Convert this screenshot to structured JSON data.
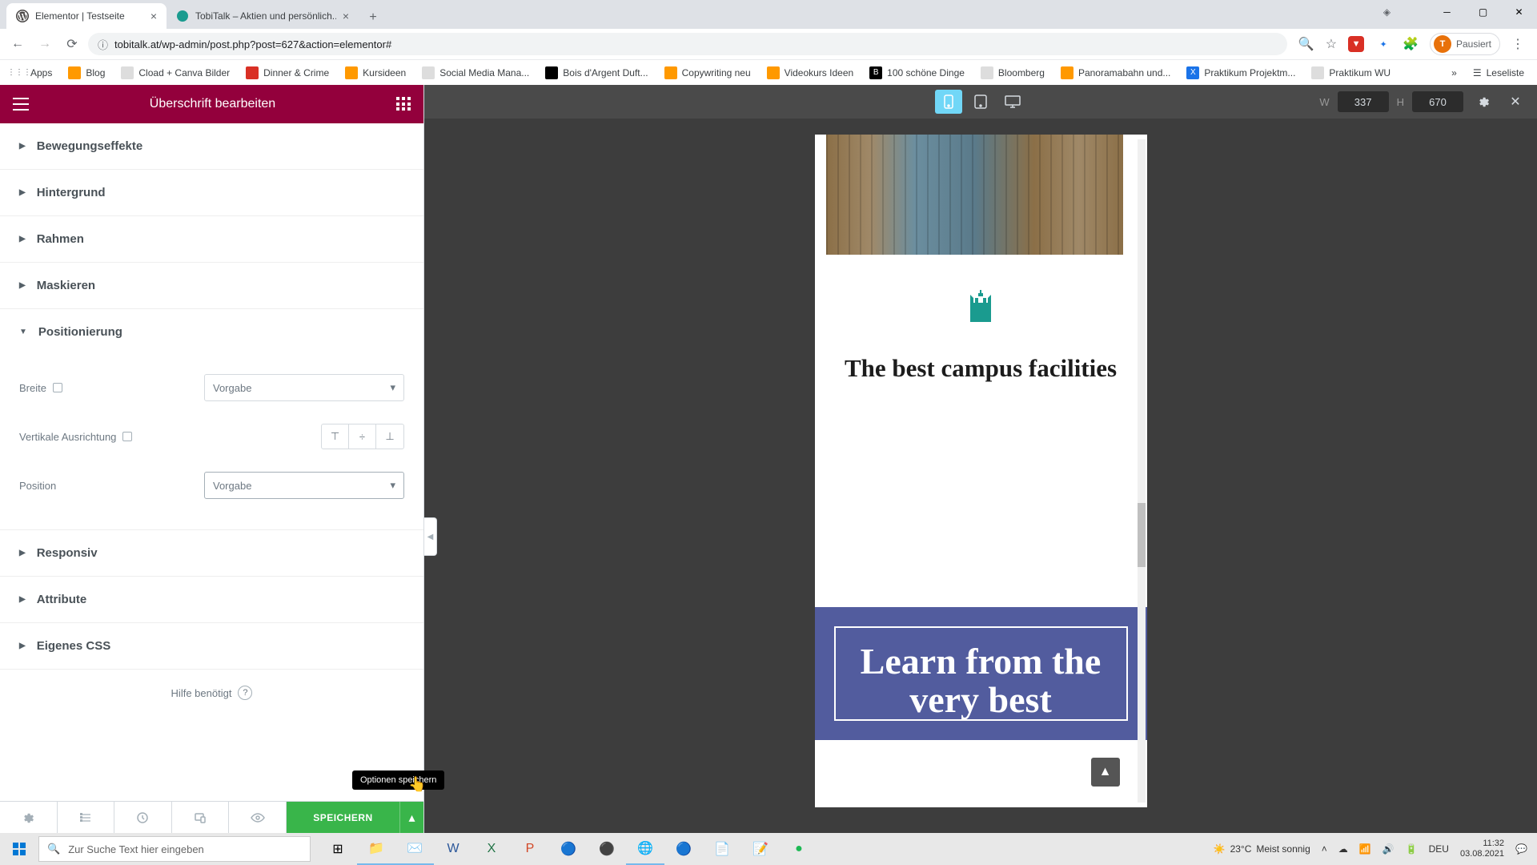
{
  "browser": {
    "tabs": [
      {
        "title": "Elementor | Testseite",
        "active": true
      },
      {
        "title": "TobiTalk – Aktien und persönlich...",
        "active": false
      }
    ],
    "url": "tobitalk.at/wp-admin/post.php?post=627&action=elementor#",
    "profile_status": "Pausiert",
    "profile_initial": "T",
    "bookmarks": [
      {
        "label": "Apps",
        "color": "#5f6368"
      },
      {
        "label": "Blog",
        "color": "#f90"
      },
      {
        "label": "Cload + Canva Bilder",
        "color": "#5f6368"
      },
      {
        "label": "Dinner & Crime",
        "color": "#d93025"
      },
      {
        "label": "Kursideen",
        "color": "#f90"
      },
      {
        "label": "Social Media Mana...",
        "color": "#5f6368"
      },
      {
        "label": "Bois d'Argent Duft...",
        "color": "#000"
      },
      {
        "label": "Copywriting neu",
        "color": "#f90"
      },
      {
        "label": "Videokurs Ideen",
        "color": "#f90"
      },
      {
        "label": "100 schöne Dinge",
        "color": "#000"
      },
      {
        "label": "Bloomberg",
        "color": "#5f6368"
      },
      {
        "label": "Panoramabahn und...",
        "color": "#f90"
      },
      {
        "label": "Praktikum Projektm...",
        "color": "#1a73e8"
      },
      {
        "label": "Praktikum WU",
        "color": "#5f6368"
      }
    ],
    "reading_list": "Leseliste"
  },
  "editor": {
    "header_title": "Überschrift bearbeiten",
    "accordions": {
      "bewegungseffekte": "Bewegungseffekte",
      "hintergrund": "Hintergrund",
      "rahmen": "Rahmen",
      "maskieren": "Maskieren",
      "positionierung": "Positionierung",
      "responsiv": "Responsiv",
      "attribute": "Attribute",
      "eigenes_css": "Eigenes CSS"
    },
    "controls": {
      "breite_label": "Breite",
      "breite_value": "Vorgabe",
      "valign_label": "Vertikale Ausrichtung",
      "position_label": "Position",
      "position_value": "Vorgabe"
    },
    "help_label": "Hilfe benötigt",
    "save_label": "SPEICHERN",
    "tooltip": "Optionen speichern"
  },
  "preview": {
    "width_label": "W",
    "width_value": "337",
    "height_label": "H",
    "height_value": "670",
    "campus_title": "The best campus facilities",
    "learn_title": "Learn from the very best"
  },
  "taskbar": {
    "search_placeholder": "Zur Suche Text hier eingeben",
    "weather_temp": "23°C",
    "weather_text": "Meist sonnig",
    "lang": "DEU",
    "time": "11:32",
    "date": "03.08.2021"
  }
}
